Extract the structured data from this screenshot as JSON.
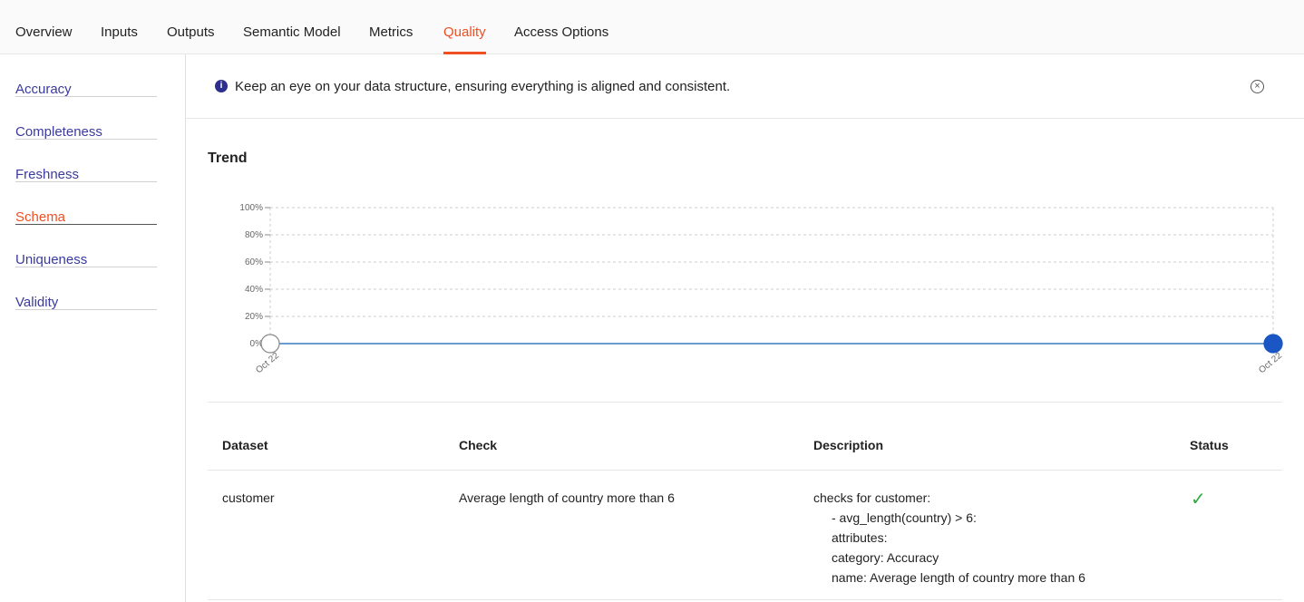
{
  "tabs": [
    {
      "label": "Overview"
    },
    {
      "label": "Inputs"
    },
    {
      "label": "Outputs"
    },
    {
      "label": "Semantic Model"
    },
    {
      "label": "Metrics"
    },
    {
      "label": "Quality",
      "active": true
    },
    {
      "label": "Access Options"
    }
  ],
  "sidebar": {
    "items": [
      {
        "label": "Accuracy"
      },
      {
        "label": "Completeness"
      },
      {
        "label": "Freshness"
      },
      {
        "label": "Schema",
        "active": true
      },
      {
        "label": "Uniqueness"
      },
      {
        "label": "Validity"
      }
    ]
  },
  "banner": {
    "text": "Keep an eye on your data structure, ensuring everything is aligned and consistent.",
    "icon": "info-icon",
    "close_icon": "close-circle-icon"
  },
  "trend": {
    "title": "Trend"
  },
  "chart_data": {
    "type": "line",
    "x": [
      "Oct 22",
      "Oct 22"
    ],
    "values": [
      0,
      0
    ],
    "ylim": [
      0,
      100
    ],
    "yticks": [
      "0%",
      "20%",
      "40%",
      "60%",
      "80%",
      "100%"
    ],
    "grid": true,
    "line_color": "#6a9bd1",
    "point_color": "#1a56c4"
  },
  "table": {
    "headers": [
      "Dataset",
      "Check",
      "Description",
      "Status"
    ],
    "rows": [
      {
        "dataset": "customer",
        "check": "Average length of country more than 6",
        "description": [
          "checks for customer:",
          "- avg_length(country) > 6:",
          "attributes:",
          "category: Accuracy",
          "name: Average length of country more than 6"
        ],
        "status": "passed",
        "status_icon": "check-icon",
        "status_color": "#2eaa3f"
      }
    ]
  }
}
